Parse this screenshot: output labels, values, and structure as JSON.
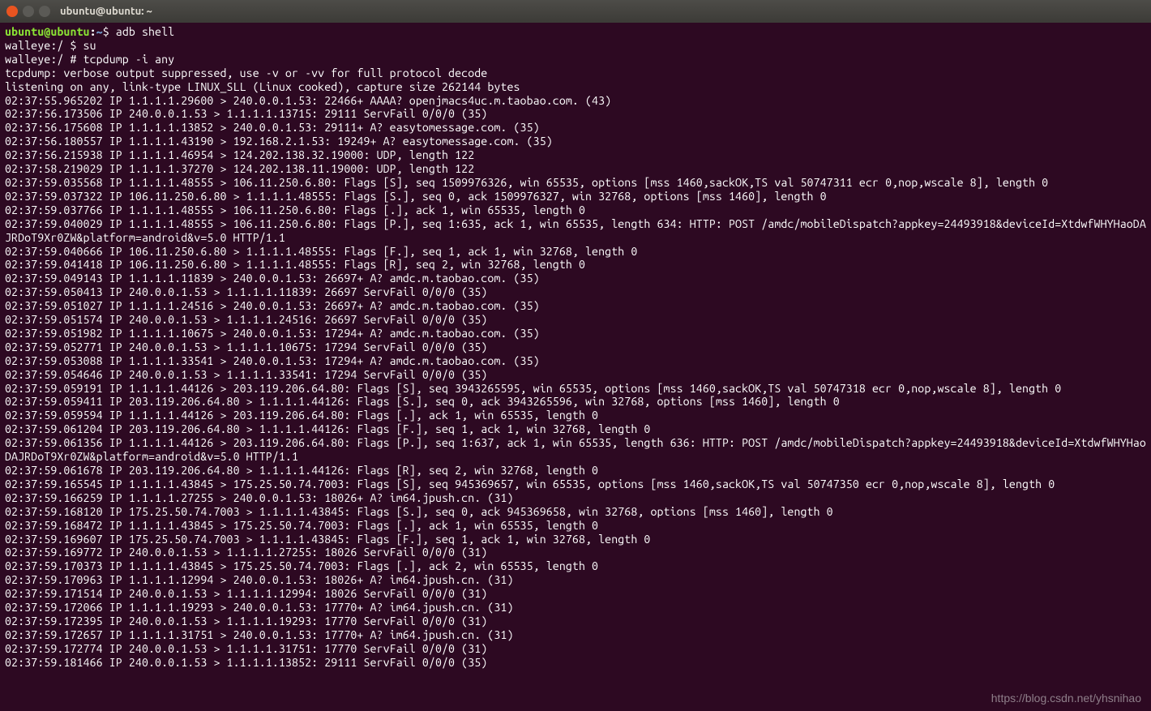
{
  "titlebar": {
    "title": "ubuntu@ubuntu: ~"
  },
  "prompt1": {
    "user_host": "ubuntu@ubuntu",
    "colon": ":",
    "path": "~",
    "symbol": "$ ",
    "command": "adb shell"
  },
  "prompt2": {
    "full": "walleye:/ $ su"
  },
  "prompt3": {
    "full": "walleye:/ # tcpdump -i any"
  },
  "output": [
    "tcpdump: verbose output suppressed, use -v or -vv for full protocol decode",
    "listening on any, link-type LINUX_SLL (Linux cooked), capture size 262144 bytes",
    "02:37:55.965202 IP 1.1.1.1.29600 > 240.0.0.1.53: 22466+ AAAA? openjmacs4uc.m.taobao.com. (43)",
    "02:37:56.173506 IP 240.0.0.1.53 > 1.1.1.1.13715: 29111 ServFail 0/0/0 (35)",
    "02:37:56.175608 IP 1.1.1.1.13852 > 240.0.0.1.53: 29111+ A? easytomessage.com. (35)",
    "02:37:56.180557 IP 1.1.1.1.43190 > 192.168.2.1.53: 19249+ A? easytomessage.com. (35)",
    "02:37:56.215938 IP 1.1.1.1.46954 > 124.202.138.32.19000: UDP, length 122",
    "02:37:58.219029 IP 1.1.1.1.37270 > 124.202.138.11.19000: UDP, length 122",
    "02:37:59.035568 IP 1.1.1.1.48555 > 106.11.250.6.80: Flags [S], seq 1509976326, win 65535, options [mss 1460,sackOK,TS val 50747311 ecr 0,nop,wscale 8], length 0",
    "02:37:59.037322 IP 106.11.250.6.80 > 1.1.1.1.48555: Flags [S.], seq 0, ack 1509976327, win 32768, options [mss 1460], length 0",
    "02:37:59.037766 IP 1.1.1.1.48555 > 106.11.250.6.80: Flags [.], ack 1, win 65535, length 0",
    "02:37:59.040029 IP 1.1.1.1.48555 > 106.11.250.6.80: Flags [P.], seq 1:635, ack 1, win 65535, length 634: HTTP: POST /amdc/mobileDispatch?appkey=24493918&deviceId=XtdwfWHYHaoDAJRDoT9Xr0ZW&platform=android&v=5.0 HTTP/1.1",
    "02:37:59.040666 IP 106.11.250.6.80 > 1.1.1.1.48555: Flags [F.], seq 1, ack 1, win 32768, length 0",
    "02:37:59.041418 IP 106.11.250.6.80 > 1.1.1.1.48555: Flags [R], seq 2, win 32768, length 0",
    "02:37:59.049143 IP 1.1.1.1.11839 > 240.0.0.1.53: 26697+ A? amdc.m.taobao.com. (35)",
    "02:37:59.050413 IP 240.0.0.1.53 > 1.1.1.1.11839: 26697 ServFail 0/0/0 (35)",
    "02:37:59.051027 IP 1.1.1.1.24516 > 240.0.0.1.53: 26697+ A? amdc.m.taobao.com. (35)",
    "02:37:59.051574 IP 240.0.0.1.53 > 1.1.1.1.24516: 26697 ServFail 0/0/0 (35)",
    "02:37:59.051982 IP 1.1.1.1.10675 > 240.0.0.1.53: 17294+ A? amdc.m.taobao.com. (35)",
    "02:37:59.052771 IP 240.0.0.1.53 > 1.1.1.1.10675: 17294 ServFail 0/0/0 (35)",
    "02:37:59.053088 IP 1.1.1.1.33541 > 240.0.0.1.53: 17294+ A? amdc.m.taobao.com. (35)",
    "02:37:59.054646 IP 240.0.0.1.53 > 1.1.1.1.33541: 17294 ServFail 0/0/0 (35)",
    "02:37:59.059191 IP 1.1.1.1.44126 > 203.119.206.64.80: Flags [S], seq 3943265595, win 65535, options [mss 1460,sackOK,TS val 50747318 ecr 0,nop,wscale 8], length 0",
    "02:37:59.059411 IP 203.119.206.64.80 > 1.1.1.1.44126: Flags [S.], seq 0, ack 3943265596, win 32768, options [mss 1460], length 0",
    "02:37:59.059594 IP 1.1.1.1.44126 > 203.119.206.64.80: Flags [.], ack 1, win 65535, length 0",
    "02:37:59.061204 IP 203.119.206.64.80 > 1.1.1.1.44126: Flags [F.], seq 1, ack 1, win 32768, length 0",
    "02:37:59.061356 IP 1.1.1.1.44126 > 203.119.206.64.80: Flags [P.], seq 1:637, ack 1, win 65535, length 636: HTTP: POST /amdc/mobileDispatch?appkey=24493918&deviceId=XtdwfWHYHaoDAJRDoT9Xr0ZW&platform=android&v=5.0 HTTP/1.1",
    "02:37:59.061678 IP 203.119.206.64.80 > 1.1.1.1.44126: Flags [R], seq 2, win 32768, length 0",
    "02:37:59.165545 IP 1.1.1.1.43845 > 175.25.50.74.7003: Flags [S], seq 945369657, win 65535, options [mss 1460,sackOK,TS val 50747350 ecr 0,nop,wscale 8], length 0",
    "02:37:59.166259 IP 1.1.1.1.27255 > 240.0.0.1.53: 18026+ A? im64.jpush.cn. (31)",
    "02:37:59.168120 IP 175.25.50.74.7003 > 1.1.1.1.43845: Flags [S.], seq 0, ack 945369658, win 32768, options [mss 1460], length 0",
    "02:37:59.168472 IP 1.1.1.1.43845 > 175.25.50.74.7003: Flags [.], ack 1, win 65535, length 0",
    "02:37:59.169607 IP 175.25.50.74.7003 > 1.1.1.1.43845: Flags [F.], seq 1, ack 1, win 32768, length 0",
    "02:37:59.169772 IP 240.0.0.1.53 > 1.1.1.1.27255: 18026 ServFail 0/0/0 (31)",
    "02:37:59.170373 IP 1.1.1.1.43845 > 175.25.50.74.7003: Flags [.], ack 2, win 65535, length 0",
    "02:37:59.170963 IP 1.1.1.1.12994 > 240.0.0.1.53: 18026+ A? im64.jpush.cn. (31)",
    "02:37:59.171514 IP 240.0.0.1.53 > 1.1.1.1.12994: 18026 ServFail 0/0/0 (31)",
    "02:37:59.172066 IP 1.1.1.1.19293 > 240.0.0.1.53: 17770+ A? im64.jpush.cn. (31)",
    "02:37:59.172395 IP 240.0.0.1.53 > 1.1.1.1.19293: 17770 ServFail 0/0/0 (31)",
    "02:37:59.172657 IP 1.1.1.1.31751 > 240.0.0.1.53: 17770+ A? im64.jpush.cn. (31)",
    "02:37:59.172774 IP 240.0.0.1.53 > 1.1.1.1.31751: 17770 ServFail 0/0/0 (31)",
    "02:37:59.181466 IP 240.0.0.1.53 > 1.1.1.1.13852: 29111 ServFail 0/0/0 (35)"
  ],
  "watermark": "https://blog.csdn.net/yhsnihao"
}
